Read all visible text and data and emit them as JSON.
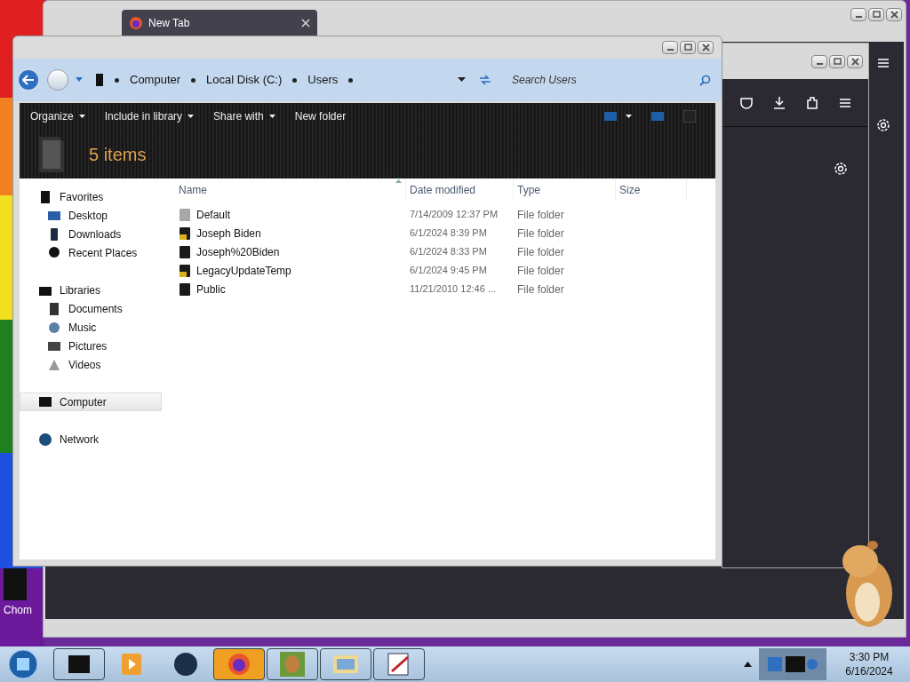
{
  "desktop": {
    "icon_labels": [
      "Chom"
    ]
  },
  "browser": {
    "tab_title": "New Tab"
  },
  "explorer": {
    "breadcrumbs": [
      "Computer",
      "Local Disk (C:)",
      "Users"
    ],
    "search": {
      "placeholder": "Search Users"
    },
    "toolbar": [
      {
        "label": "Organize",
        "menu": true
      },
      {
        "label": "Include in library",
        "menu": true
      },
      {
        "label": "Share with",
        "menu": true
      },
      {
        "label": "New folder",
        "menu": false
      }
    ],
    "item_count": "5 items",
    "nav": [
      {
        "label": "Favorites",
        "kind": "favorites",
        "selected": false,
        "children": [
          {
            "label": "Desktop",
            "kind": "desktop",
            "selected": false
          },
          {
            "label": "Downloads",
            "kind": "downloads",
            "selected": false
          },
          {
            "label": "Recent Places",
            "kind": "recent",
            "selected": false
          }
        ]
      },
      {
        "label": "Libraries",
        "kind": "libraries",
        "selected": false,
        "children": [
          {
            "label": "Documents",
            "kind": "documents",
            "selected": false
          },
          {
            "label": "Music",
            "kind": "music",
            "selected": false
          },
          {
            "label": "Pictures",
            "kind": "pictures",
            "selected": false
          },
          {
            "label": "Videos",
            "kind": "videos",
            "selected": false
          }
        ]
      },
      {
        "label": "Computer",
        "kind": "computer",
        "selected": true
      },
      {
        "label": "Network",
        "kind": "network",
        "selected": false
      }
    ],
    "columns": [
      {
        "label": "Name",
        "sorted": true
      },
      {
        "label": "Date modified",
        "sorted": false
      },
      {
        "label": "Type",
        "sorted": false
      },
      {
        "label": "Size",
        "sorted": false
      }
    ],
    "rows": [
      {
        "name": "Default",
        "kind": "grey",
        "date": "7/14/2009 12:37 PM",
        "type": "File folder"
      },
      {
        "name": "Joseph Biden",
        "kind": "locked",
        "date": "6/1/2024 8:39 PM",
        "type": "File folder"
      },
      {
        "name": "Joseph%20Biden",
        "kind": "plain",
        "date": "6/1/2024 8:33 PM",
        "type": "File folder"
      },
      {
        "name": "LegacyUpdateTemp",
        "kind": "locked",
        "date": "6/1/2024 9:45 PM",
        "type": "File folder"
      },
      {
        "name": "Public",
        "kind": "plain",
        "date": "11/21/2010 12:46 ...",
        "type": "File folder"
      }
    ]
  },
  "taskbar": {
    "apps": [
      {
        "kind": "box"
      },
      {
        "kind": "media"
      },
      {
        "kind": "globe"
      },
      {
        "kind": "firefox"
      },
      {
        "kind": "game"
      },
      {
        "kind": "mail"
      },
      {
        "kind": "paint"
      }
    ],
    "clock": {
      "time": "3:30 PM",
      "date": "6/16/2024"
    }
  }
}
